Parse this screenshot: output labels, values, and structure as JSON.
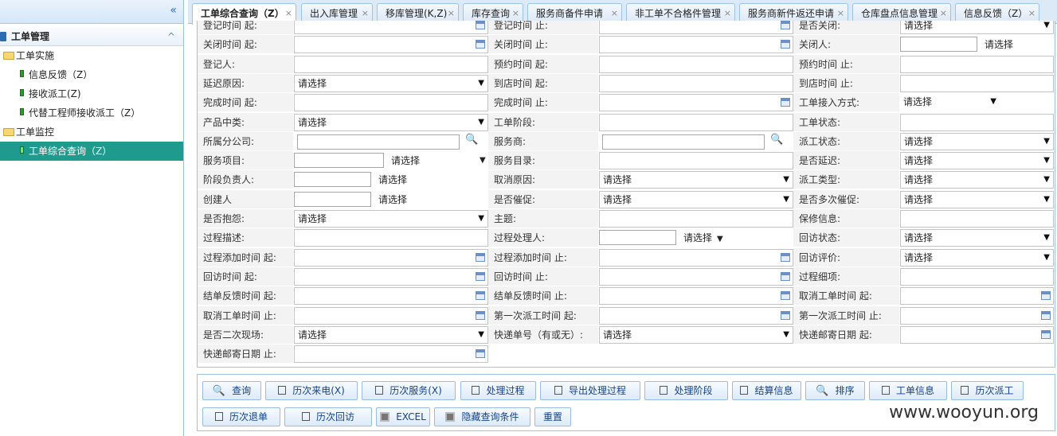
{
  "sidebar": {
    "collapse_icon": "«",
    "title": "工单管理",
    "caret": "^",
    "nodes": [
      {
        "type": "folder",
        "label": "工单实施"
      },
      {
        "type": "leaf",
        "label": "信息反馈（Z）"
      },
      {
        "type": "leaf",
        "label": "接收派工(Z)"
      },
      {
        "type": "leaf",
        "label": "代替工程师接收派工（Z）"
      },
      {
        "type": "folder",
        "label": "工单监控"
      },
      {
        "type": "leaf",
        "label": "工单综合查询（Z）",
        "active": true
      }
    ]
  },
  "tabs": [
    {
      "label": "工单综合查询（Z）",
      "active": true
    },
    {
      "label": "出入库管理"
    },
    {
      "label": "移库管理(K,Z)"
    },
    {
      "label": "库存查询"
    },
    {
      "label": "服务商备件申请"
    },
    {
      "label": "非工单不合格件管理"
    },
    {
      "label": "服务商新件返还申请"
    },
    {
      "label": "仓库盘点信息管理"
    },
    {
      "label": "信息反馈（Z）"
    }
  ],
  "tab_close": "×",
  "select_placeholder": "请选择",
  "select_arrow": "▼",
  "form": {
    "rows": [
      [
        "登记时间 起:",
        "登记时间 止:",
        "是否关闭:"
      ],
      [
        "关闭时间 起:",
        "关闭时间 止:",
        "关闭人:"
      ],
      [
        "登记人:",
        "预约时间 起:",
        "预约时间 止:"
      ],
      [
        "延迟原因:",
        "到店时间 起:",
        "到店时间 止:"
      ],
      [
        "完成时间 起:",
        "完成时间 止:",
        "工单接入方式:"
      ],
      [
        "产品中类:",
        "工单阶段:",
        "工单状态:"
      ],
      [
        "所属分公司:",
        "服务商:",
        "派工状态:"
      ],
      [
        "服务项目:",
        "服务目录:",
        "是否延迟:"
      ],
      [
        "阶段负责人:",
        "取消原因:",
        "派工类型:"
      ],
      [
        "创建人",
        "是否催促:",
        "是否多次催促:"
      ],
      [
        "是否抱怨:",
        "主题:",
        "保修信息:"
      ],
      [
        "过程描述:",
        "过程处理人:",
        "回访状态:"
      ],
      [
        "过程添加时间 起:",
        "过程添加时间 止:",
        "回访评价:"
      ],
      [
        "回访时间 起:",
        "回访时间 止:",
        "过程细项:"
      ],
      [
        "结单反馈时间 起:",
        "结单反馈时间 止:",
        "取消工单时间 起:"
      ],
      [
        "取消工单时间 止:",
        "第一次派工时间 起:",
        "第一次派工时间 止:"
      ],
      [
        "是否二次现场:",
        "快递单号（有或无）:",
        "快递邮寄日期 起:"
      ],
      [
        "快递邮寄日期 止:",
        "",
        ""
      ]
    ]
  },
  "buttons": {
    "row1": [
      {
        "label": "查询",
        "icon": "search-icon"
      },
      {
        "label": "历次来电(X)",
        "icon": "edit-icon"
      },
      {
        "label": "历次服务(X)",
        "icon": "edit-icon"
      },
      {
        "label": "处理过程",
        "icon": "edit-icon"
      },
      {
        "label": "导出处理过程",
        "icon": "edit-icon"
      },
      {
        "label": "处理阶段",
        "icon": "edit-icon"
      },
      {
        "label": "结算信息",
        "icon": "edit-icon"
      },
      {
        "label": "排序",
        "icon": "search-icon"
      },
      {
        "label": "工单信息",
        "icon": "edit-icon"
      },
      {
        "label": "历次派工",
        "icon": "edit-icon"
      }
    ],
    "row2": [
      {
        "label": "历次退单",
        "icon": "edit-icon"
      },
      {
        "label": "历次回访",
        "icon": "edit-icon"
      },
      {
        "label": "EXCEL",
        "icon": "grid-icon"
      },
      {
        "label": "隐藏查询条件",
        "icon": "grid-icon"
      },
      {
        "label": "重置",
        "icon": ""
      }
    ]
  },
  "watermark": "www.wooyun.org"
}
